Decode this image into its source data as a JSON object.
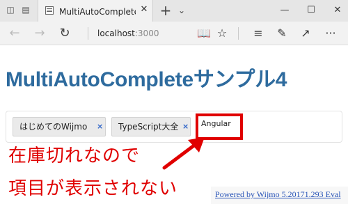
{
  "browser": {
    "tab_title": "MultiAutoCompleteサン",
    "address_host": "localhost",
    "address_port": ":3000"
  },
  "page": {
    "title": "MultiAutoCompleteサンプル4"
  },
  "multi_autocomplete": {
    "tokens": [
      {
        "label": "はじめてのWijmo",
        "remove": "×"
      },
      {
        "label": "TypeScript大全",
        "remove": "×"
      }
    ],
    "input_value": "Angular"
  },
  "annotation": {
    "line1": "在庫切れなので",
    "line2": "項目が表示されない",
    "color": "#e00000"
  },
  "footer": {
    "powered_by": "Powered by Wijmo 5.20171.293 Eval"
  },
  "colors": {
    "title": "#2e6b9e",
    "link": "#2a55b8",
    "highlight": "#e00000"
  }
}
